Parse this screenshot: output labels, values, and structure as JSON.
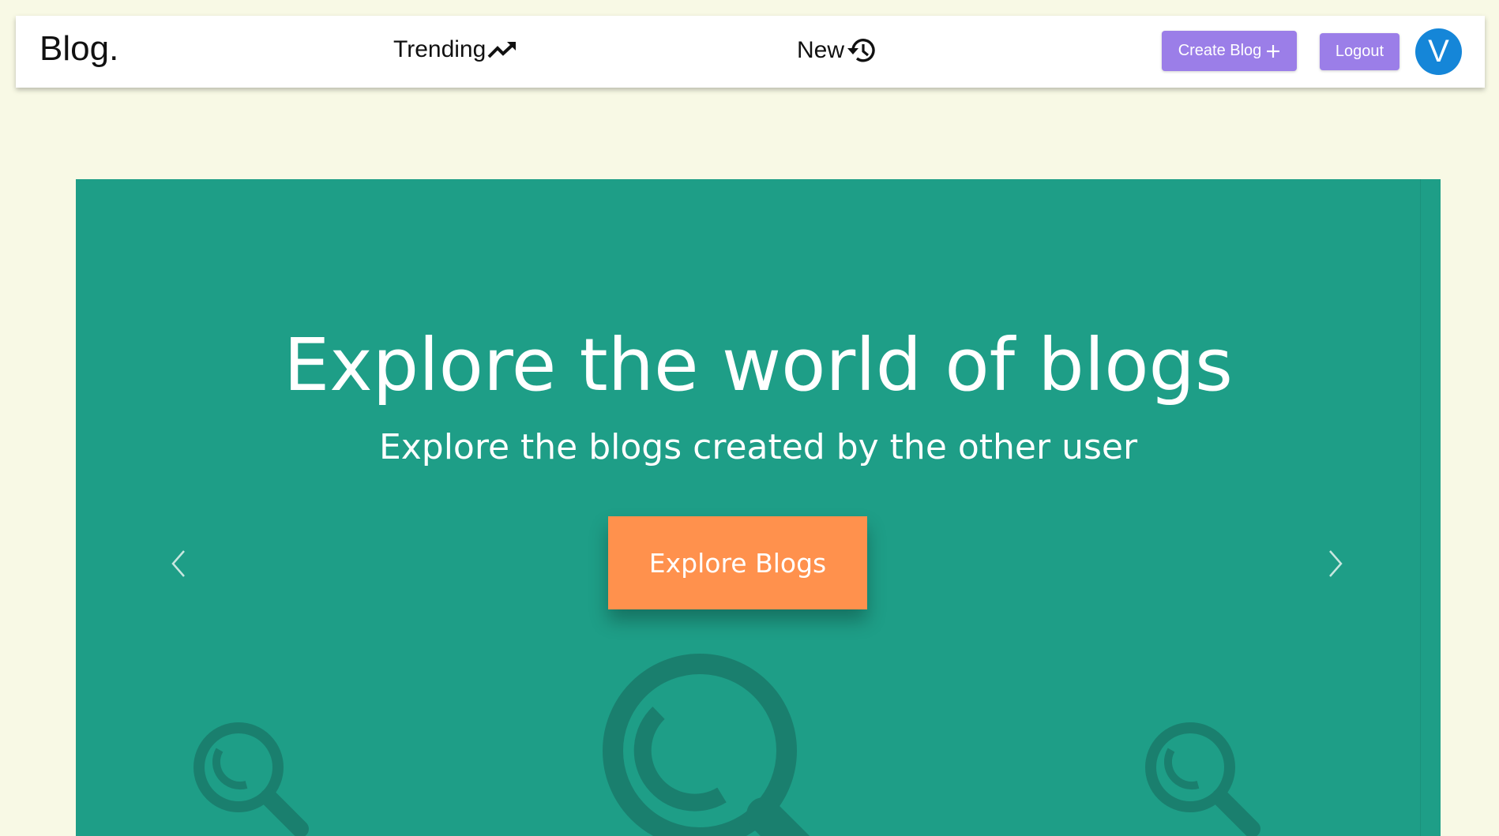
{
  "navbar": {
    "brand": "Blog.",
    "links": [
      {
        "label": "Trending",
        "icon": "trending-up-icon"
      },
      {
        "label": "New",
        "icon": "history-icon"
      }
    ],
    "create_label": "Create Blog",
    "logout_label": "Logout",
    "avatar_initial": "V"
  },
  "hero": {
    "title": "Explore the world of blogs",
    "subtitle": "Explore the blogs created by the other user",
    "cta_label": "Explore Blogs"
  },
  "colors": {
    "page_bg": "#f8f9e5",
    "hero_bg": "#1e9e87",
    "cta_bg": "#ff914d",
    "purple_button": "#9b7ee8",
    "avatar_bg": "#1586d8"
  }
}
